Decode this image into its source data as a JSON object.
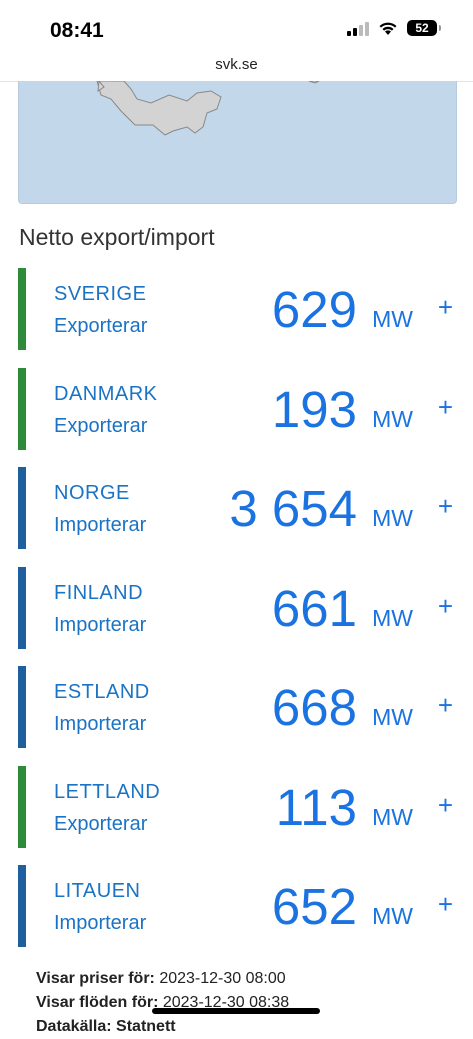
{
  "status_bar": {
    "time": "08:41",
    "battery": "52"
  },
  "browser": {
    "url": "svk.se"
  },
  "section": {
    "title": "Netto export/import"
  },
  "colors": {
    "export": "#2e8b3a",
    "import": "#1f5f9e",
    "link": "#1a73e0"
  },
  "countries": [
    {
      "name": "SVERIGE",
      "status": "Exporterar",
      "value": "629",
      "unit": "MW",
      "type": "export"
    },
    {
      "name": "DANMARK",
      "status": "Exporterar",
      "value": "193",
      "unit": "MW",
      "type": "export"
    },
    {
      "name": "NORGE",
      "status": "Importerar",
      "value": "3 654",
      "unit": "MW",
      "type": "import"
    },
    {
      "name": "FINLAND",
      "status": "Importerar",
      "value": "661",
      "unit": "MW",
      "type": "import"
    },
    {
      "name": "ESTLAND",
      "status": "Importerar",
      "value": "668",
      "unit": "MW",
      "type": "import"
    },
    {
      "name": "LETTLAND",
      "status": "Exporterar",
      "value": "113",
      "unit": "MW",
      "type": "export"
    },
    {
      "name": "LITAUEN",
      "status": "Importerar",
      "value": "652",
      "unit": "MW",
      "type": "import"
    }
  ],
  "footer": {
    "prices_label": "Visar priser för:",
    "prices_value": "2023-12-30 08:00",
    "flows_label": "Visar flöden för:",
    "flows_value": "2023-12-30 08:38",
    "source_partial": "Datakälla: Statnett"
  }
}
